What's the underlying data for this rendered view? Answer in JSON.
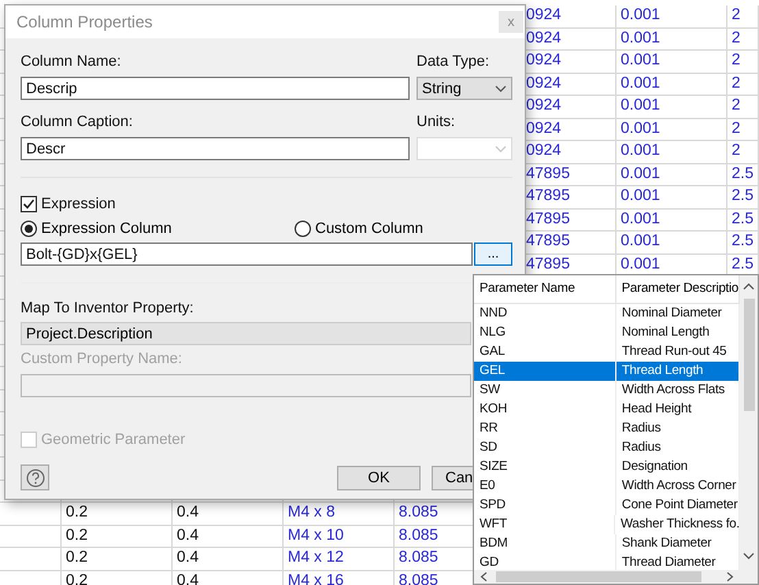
{
  "sheet": {
    "top_rows": [
      {
        "column_5": "0924",
        "column_6": "0.001",
        "column_7": "2"
      },
      {
        "column_5": "0924",
        "column_6": "0.001",
        "column_7": "2"
      },
      {
        "column_5": "0924",
        "column_6": "0.001",
        "column_7": "2"
      },
      {
        "column_5": "0924",
        "column_6": "0.001",
        "column_7": "2"
      },
      {
        "column_5": "0924",
        "column_6": "0.001",
        "column_7": "2"
      },
      {
        "column_5": "0924",
        "column_6": "0.001",
        "column_7": "2"
      },
      {
        "column_5": "0924",
        "column_6": "0.001",
        "column_7": "2"
      },
      {
        "column_5": "47895",
        "column_6": "0.001",
        "column_7": "2.5"
      },
      {
        "column_5": "47895",
        "column_6": "0.001",
        "column_7": "2.5"
      },
      {
        "column_5": "47895",
        "column_6": "0.001",
        "column_7": "2.5"
      },
      {
        "column_5": "47895",
        "column_6": "0.001",
        "column_7": "2.5"
      },
      {
        "column_5": "47895",
        "column_6": "0.001",
        "column_7": "2.5"
      }
    ],
    "bottom_rows": [
      {
        "column_2": "0.2",
        "column_3": "0.4",
        "column_4": "M4 x 8",
        "column_5": "8.085"
      },
      {
        "column_2": "0.2",
        "column_3": "0.4",
        "column_4": "M4 x 10",
        "column_5": "8.085"
      },
      {
        "column_2": "0.2",
        "column_3": "0.4",
        "column_4": "M4 x 12",
        "column_5": "8.085"
      },
      {
        "column_2": "0.2",
        "column_3": "0.4",
        "column_4": "M4 x 16",
        "column_5": "8.085"
      }
    ]
  },
  "dialog": {
    "title": "Column Properties",
    "close_button": "x",
    "column_name": {
      "label": "Column Name:",
      "value": "Descrip"
    },
    "data_type": {
      "label": "Data Type:",
      "value": "String"
    },
    "column_caption": {
      "label": "Column Caption:",
      "value": "Descr"
    },
    "units": {
      "label": "Units:",
      "disabled": true
    },
    "expression": {
      "label": "Expression",
      "checked": true
    },
    "column_types": [
      {
        "label": "Expression Column",
        "selected": true
      },
      {
        "label": "Custom Column",
        "selected": false
      }
    ],
    "expression_field": {
      "value": "Bolt-{GD}x{GEL}"
    },
    "browse_button": "...",
    "map_property": {
      "label": "Map To Inventor Property:",
      "value": "Project.Description"
    },
    "custom_property": {
      "label": "Custom Property Name:",
      "disabled": true
    },
    "geometric": {
      "label": "Geometric Parameter",
      "checked": false,
      "disabled": true
    },
    "ok_button": "OK",
    "cancel_button": "Can"
  },
  "parameter_list": {
    "columns": [
      "Parameter Name",
      "Parameter Descriptio"
    ],
    "rows": [
      {
        "name": "NND",
        "description": "Nominal Diameter",
        "selected": false
      },
      {
        "name": "NLG",
        "description": "Nominal Length",
        "selected": false
      },
      {
        "name": "GAL",
        "description": "Thread Run-out 45",
        "selected": false
      },
      {
        "name": "GEL",
        "description": "Thread Length",
        "selected": true
      },
      {
        "name": "SW",
        "description": "Width Across Flats",
        "selected": false
      },
      {
        "name": "KOH",
        "description": "Head Height",
        "selected": false
      },
      {
        "name": "RR",
        "description": "Radius",
        "selected": false
      },
      {
        "name": "SD",
        "description": "Radius",
        "selected": false
      },
      {
        "name": "SIZE",
        "description": "Designation",
        "selected": false
      },
      {
        "name": "E0",
        "description": "Width Across Corner",
        "selected": false
      },
      {
        "name": "SPD",
        "description": "Cone Point Diameter",
        "selected": false
      },
      {
        "name": "WFT",
        "description": "Washer Thickness fo.",
        "selected": false
      },
      {
        "name": "BDM",
        "description": "Shank Diameter",
        "selected": false
      },
      {
        "name": "GD",
        "description": "Thread Diameter",
        "selected": false
      }
    ]
  }
}
